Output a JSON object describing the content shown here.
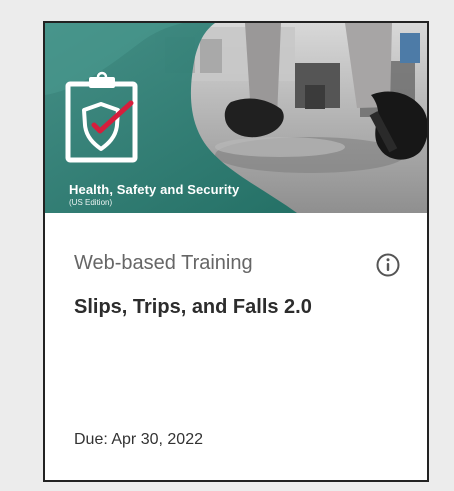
{
  "card": {
    "banner": {
      "title": "Health, Safety and Security",
      "subtitle": "(US Edition)",
      "icon": "clipboard-shield-check-icon",
      "accent_color": "#1f6f64"
    },
    "course_type": "Web-based Training",
    "course_title": "Slips, Trips, and Falls 2.0",
    "due_date": "Due: Apr 30, 2022",
    "info_icon": "info-icon"
  }
}
